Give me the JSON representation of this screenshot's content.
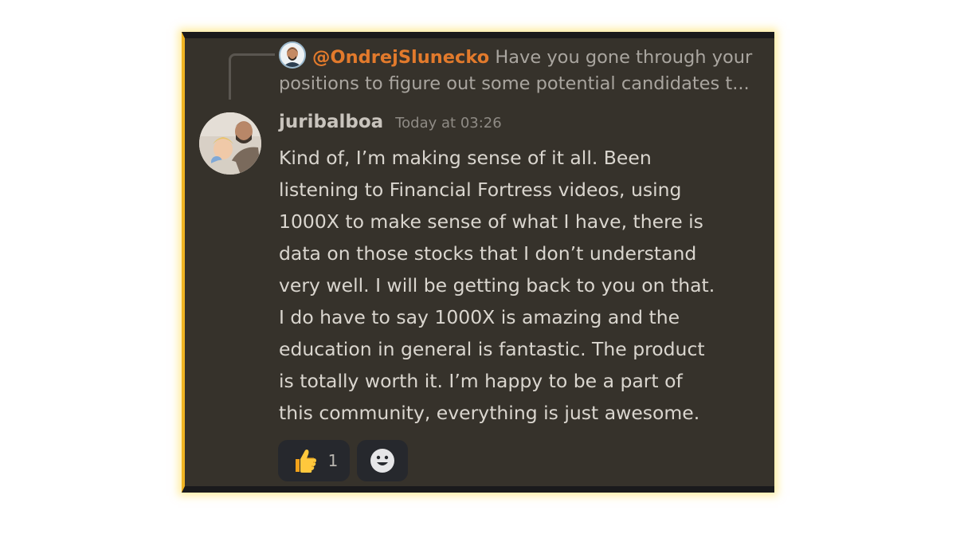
{
  "reply": {
    "mention": "@OndrejSlunecko",
    "preview": "Have you gone through your positions to figure out some potential candidates t..."
  },
  "message": {
    "username": "juribalboa",
    "timestamp": "Today at 03:26",
    "lines": [
      "Kind of, I’m making sense of it all. Been",
      "listening to Financial Fortress videos, using",
      "1000X to make sense of what I have, there is",
      "data on those stocks that I don’t understand",
      "very well. I will be getting back to you on that.",
      "I do have to say 1000X is amazing and the",
      "education in general is fantastic. The product",
      "is totally worth it. I’m happy to be a part of",
      "this community, everything is just awesome."
    ]
  },
  "reactions": [
    {
      "emoji": "thumbs-up-icon",
      "count": "1"
    },
    {
      "emoji": "add-reaction-smiley-icon"
    }
  ],
  "colors": {
    "card_bg": "#36322b",
    "accent_border": "#f0b423",
    "mention": "#e27a2c",
    "glow": "#ffdc50"
  }
}
